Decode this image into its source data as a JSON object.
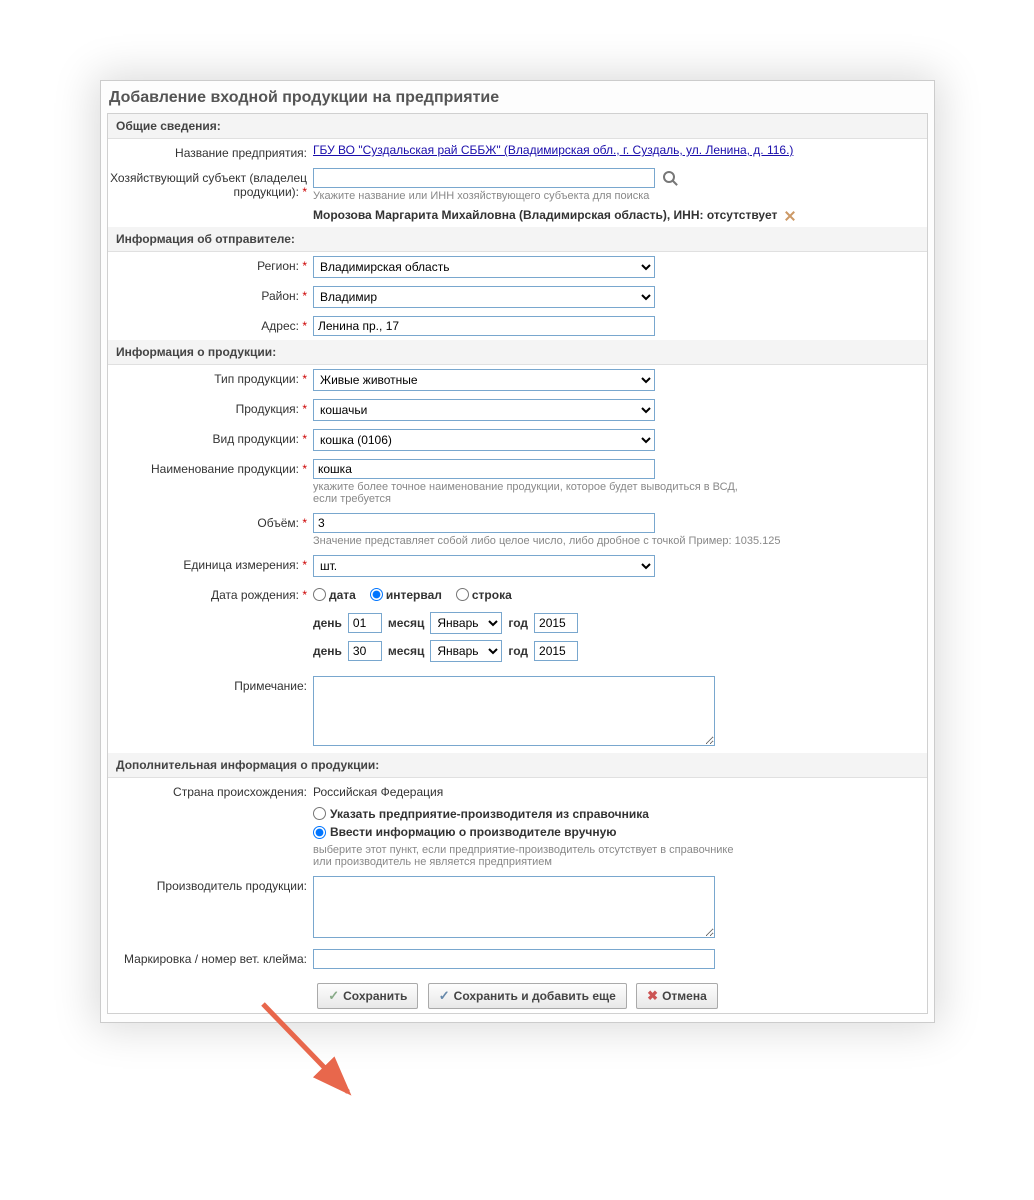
{
  "page_title": "Добавление входной продукции на предприятие",
  "sections": {
    "general": {
      "header": "Общие сведения:",
      "enterprise_label": "Название предприятия:",
      "enterprise_link": "ГБУ ВО \"Суздальская рай СББЖ\" (Владимирская обл., г. Суздаль, ул. Ленина, д. 116.)",
      "owner_label": "Хозяйствующий субъект (владелец продукции):",
      "owner_hint": "Укажите название или ИНН хозяйствующего субъекта для поиска",
      "owner_selected": "Морозова Маргарита Михайловна (Владимирская область), ИНН: отсутствует"
    },
    "sender": {
      "header": "Информация об отправителе:",
      "region_label": "Регион:",
      "region_value": "Владимирская область",
      "district_label": "Район:",
      "district_value": "Владимир",
      "address_label": "Адрес:",
      "address_value": "Ленина пр., 17"
    },
    "product": {
      "header": "Информация о продукции:",
      "type_label": "Тип продукции:",
      "type_value": "Живые животные",
      "product_label": "Продукция:",
      "product_value": "кошачьи",
      "kind_label": "Вид продукции:",
      "kind_value": "кошка (0106)",
      "name_label": "Наименование продукции:",
      "name_value": "кошка",
      "name_hint": "укажите более точное наименование продукции, которое будет выводиться в ВСД, если требуется",
      "volume_label": "Объём:",
      "volume_value": "3",
      "volume_hint": "Значение представляет собой либо целое число, либо дробное с точкой Пример: 1035.125",
      "unit_label": "Единица измерения:",
      "unit_value": "шт.",
      "birth_label": "Дата рождения:",
      "birth_radio_date": "дата",
      "birth_radio_interval": "интервал",
      "birth_radio_string": "строка",
      "day_label": "день",
      "month_label": "месяц",
      "year_label": "год",
      "month_value": "Январь",
      "from_day": "01",
      "from_year": "2015",
      "to_day": "30",
      "to_year": "2015",
      "note_label": "Примечание:"
    },
    "additional": {
      "header": "Дополнительная информация о продукции:",
      "origin_label": "Страна происхождения:",
      "origin_value": "Российская Федерация",
      "radio_directory": "Указать предприятие-производителя из справочника",
      "radio_manual": "Ввести информацию о производителе вручную",
      "radio_hint": "выберите этот пункт, если предприятие-производитель отсутствует в справочнике или производитель не является предприятием",
      "producer_label": "Производитель продукции:",
      "marking_label": "Маркировка / номер вет. клейма:"
    }
  },
  "buttons": {
    "save": "Сохранить",
    "save_add": "Сохранить и добавить еще",
    "cancel": "Отмена"
  }
}
